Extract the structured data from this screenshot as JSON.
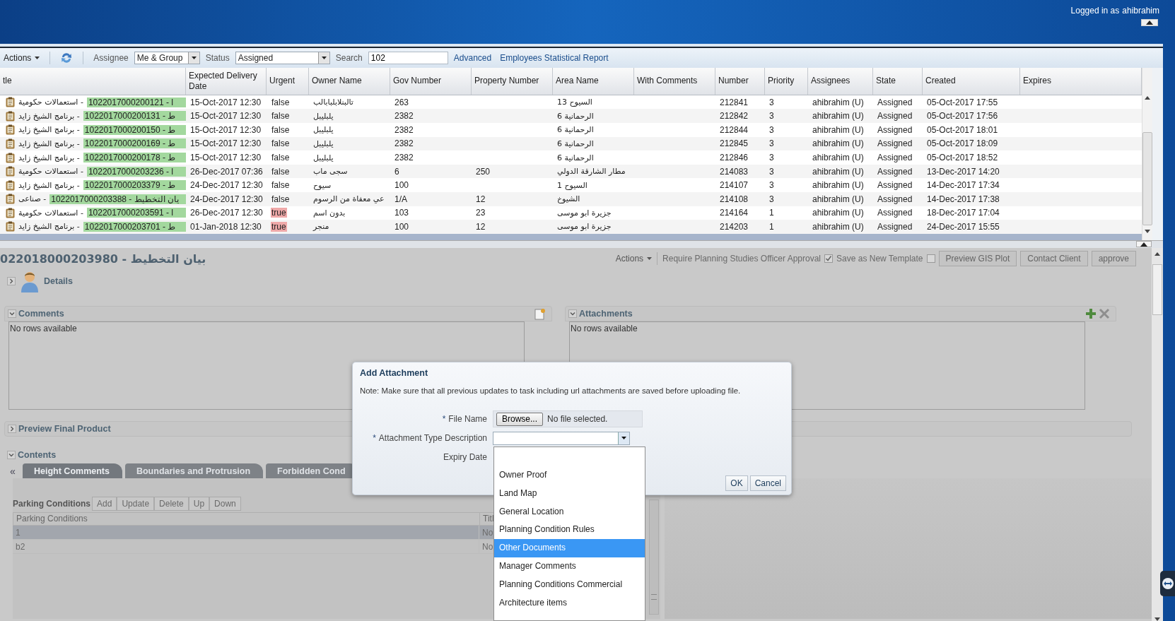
{
  "header": {
    "label": "Logged in as",
    "user": "ahibrahim"
  },
  "toolbar": {
    "actions": "Actions",
    "assignee_label": "Assignee",
    "assignee": "Me & Group",
    "status_label": "Status",
    "status": "Assigned",
    "search_label": "Search",
    "search": "102",
    "links": [
      "Advanced",
      "Employees Statistical Report"
    ]
  },
  "table": {
    "columns": [
      "tle",
      "Expected Delivery Date",
      "Urgent",
      "Owner Name",
      "Gov Number",
      "Property Number",
      "Area Name",
      "With Comments",
      "Number",
      "Priority",
      "Assignees",
      "State",
      "Created",
      "Expires"
    ],
    "rows": [
      {
        "category": "استعمالات حكومية -",
        "code": "1022017000200121 - ا",
        "delivery": "15-Oct-2017 12:30",
        "urgent": "false",
        "flagged": false,
        "owner": "تالبنلابلبابالب",
        "gov": "263",
        "area": "السيوح 13",
        "number": "212841",
        "priority": "3",
        "assignee": "ahibrahim (U)",
        "state": "Assigned",
        "created": "05-Oct-2017 17:55",
        "selected": false
      },
      {
        "category": "برنامج الشيخ زايد -",
        "code": "1022017000200131 - ط",
        "delivery": "15-Oct-2017 12:30",
        "urgent": "false",
        "flagged": false,
        "owner": "يلبليبل",
        "gov": "2382",
        "area": "الرحمانية 6",
        "number": "212842",
        "priority": "3",
        "assignee": "ahibrahim (U)",
        "state": "Assigned",
        "created": "05-Oct-2017 17:56",
        "selected": false
      },
      {
        "category": "برنامج الشيخ زايد -",
        "code": "1022017000200150 - ط",
        "delivery": "15-Oct-2017 12:30",
        "urgent": "false",
        "flagged": false,
        "owner": "يلبليبل",
        "gov": "2382",
        "area": "الرحمانية 6",
        "number": "212844",
        "priority": "3",
        "assignee": "ahibrahim (U)",
        "state": "Assigned",
        "created": "05-Oct-2017 18:01",
        "selected": false
      },
      {
        "category": "برنامج الشيخ زايد -",
        "code": "1022017000200169 - ط",
        "delivery": "15-Oct-2017 12:30",
        "urgent": "false",
        "flagged": false,
        "owner": "يلبليبل",
        "gov": "2382",
        "area": "الرحمانية 6",
        "number": "212845",
        "priority": "3",
        "assignee": "ahibrahim (U)",
        "state": "Assigned",
        "created": "05-Oct-2017 18:09",
        "selected": false
      },
      {
        "category": "برنامج الشيخ زايد -",
        "code": "1022017000200178 - ط",
        "delivery": "15-Oct-2017 12:30",
        "urgent": "false",
        "flagged": false,
        "owner": "يلبليبل",
        "gov": "2382",
        "area": "الرحمانية 6",
        "number": "212846",
        "priority": "3",
        "assignee": "ahibrahim (U)",
        "state": "Assigned",
        "created": "05-Oct-2017 18:52",
        "selected": false
      },
      {
        "category": "استعمالات حكومية -",
        "code": "1022017000203236 - ا",
        "delivery": "26-Dec-2017 07:36",
        "urgent": "false",
        "flagged": false,
        "owner": "سجى ماب",
        "gov": "6",
        "property": "250",
        "area": "مطار الشارقة الدولي",
        "number": "214083",
        "priority": "3",
        "assignee": "ahibrahim (U)",
        "state": "Assigned",
        "created": "13-Dec-2017 14:20",
        "selected": false
      },
      {
        "category": "برنامج الشيخ زايد -",
        "code": "1022017000203379 - ط",
        "delivery": "24-Dec-2017 12:30",
        "urgent": "false",
        "flagged": false,
        "owner": "سيوح",
        "gov": "100",
        "area": "السيوح 1",
        "number": "214107",
        "priority": "3",
        "assignee": "ahibrahim (U)",
        "state": "Assigned",
        "created": "14-Dec-2017 17:34",
        "selected": false
      },
      {
        "category": "صناعى -",
        "code": "1022017000203388 - يان التخطيط",
        "delivery": "24-Dec-2017 12:30",
        "urgent": "false",
        "flagged": false,
        "owner": "عي معفاة من الرسوم",
        "gov": "1/A",
        "property": "12",
        "area": "الشيوخ",
        "number": "214108",
        "priority": "3",
        "assignee": "ahibrahim (U)",
        "state": "Assigned",
        "created": "14-Dec-2017 17:38",
        "selected": false
      },
      {
        "category": "استعمالات حكومية -",
        "code": "1022017000203591 - ا",
        "delivery": "26-Dec-2017 12:30",
        "urgent": "true",
        "flagged": true,
        "owner": "بدون اسم",
        "gov": "103",
        "property": "23",
        "area": "جزيرة ابو موسى",
        "number": "214164",
        "priority": "1",
        "assignee": "ahibrahim (U)",
        "state": "Assigned",
        "created": "18-Dec-2017 17:04",
        "selected": false
      },
      {
        "category": "برنامج الشيخ زايد -",
        "code": "1022017000203701 - ط",
        "delivery": "01-Jan-2018 12:30",
        "urgent": "true",
        "flagged": true,
        "owner": "منجر",
        "gov": "100",
        "property": "12",
        "area": "جزيرة ابو موسى",
        "number": "214203",
        "priority": "1",
        "assignee": "ahibrahim (U)",
        "state": "Assigned",
        "created": "24-Dec-2017 15:55",
        "selected": false
      },
      {
        "selected": true
      }
    ]
  },
  "task": {
    "title": "022018000203980 - بيان التخطيط",
    "actions": "Actions",
    "options": [
      {
        "label": "Require Planning Studies Officer Approval",
        "checked": true
      },
      {
        "label": "Save as New Template",
        "checked": false
      }
    ],
    "buttons": [
      "Preview GIS Plot",
      "Contact Client",
      "approve"
    ],
    "details": {
      "label": "Details",
      "expanded": false
    },
    "comments": {
      "label": "Comments",
      "expanded": true,
      "empty_text": "No rows available"
    },
    "attachments": {
      "label": "Attachments",
      "expanded": true,
      "empty_text": "No rows available"
    },
    "preview": {
      "label": "Preview Final Product",
      "expanded": false
    },
    "contents": {
      "label": "Contents",
      "expanded": true,
      "back": "«",
      "tabs": [
        {
          "label": "Height Comments",
          "selected": true
        },
        {
          "label": "Boundaries and Protrusion",
          "selected": false
        },
        {
          "label": "Forbidden Cond",
          "selected": false
        }
      ],
      "parking": {
        "label": "Parking Conditions",
        "buttons": [
          "Add",
          "Update",
          "Delete",
          "Up",
          "Down"
        ],
        "columns": [
          "Parking Conditions",
          "Titl"
        ],
        "rows": [
          {
            "cells": [
              "1",
              "No"
            ],
            "selected": true
          },
          {
            "cells": [
              "b2",
              "No"
            ],
            "selected": false
          }
        ]
      }
    }
  },
  "dialog": {
    "title": "Add Attachment",
    "note": "Note: Make sure that all previous updates to task including url attachments are saved before uploading file.",
    "fields": [
      {
        "kind": "file",
        "marker": "*",
        "label": "File Name",
        "button": "Browse...",
        "value": "No file selected."
      },
      {
        "kind": "select",
        "marker": "*",
        "label": "Attachment Type Description"
      },
      {
        "kind": "date",
        "label": "Expiry Date"
      }
    ],
    "options": [
      {
        "label": "Owner Proof",
        "selected": false
      },
      {
        "label": "Land Map",
        "selected": false
      },
      {
        "label": "General Location",
        "selected": false
      },
      {
        "label": "Planning Condition Rules",
        "selected": false
      },
      {
        "label": "Other Documents",
        "selected": true
      },
      {
        "label": "Manager Comments",
        "selected": false
      },
      {
        "label": "Planning Conditions Commercial",
        "selected": false
      },
      {
        "label": "Architecture items",
        "selected": false
      }
    ],
    "buttons": [
      "OK",
      "Cancel"
    ]
  }
}
